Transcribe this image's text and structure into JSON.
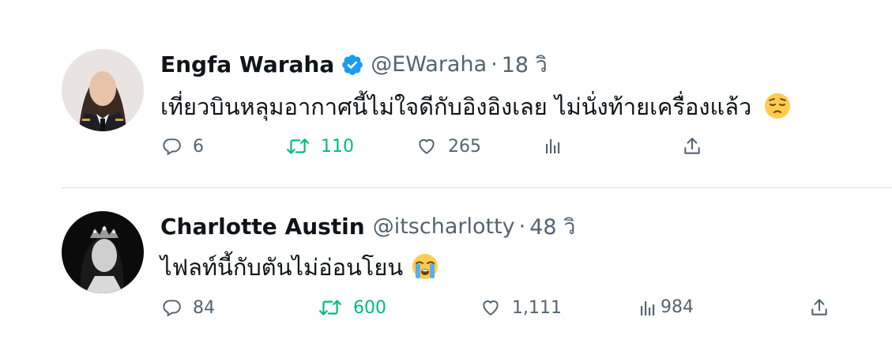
{
  "tweets": [
    {
      "display_name": "Engfa Waraha",
      "verified": true,
      "handle": "@EWaraha",
      "separator": "·",
      "time": "18 วิ",
      "text": "เที่ยวบินหลุมอากาศนี้ไม่ใจดีกับอิงอิงเลย ไม่นั่งท้ายเครื่องแล้ว",
      "emoji": "pensive-face",
      "replies": "6",
      "retweets": "110",
      "likes": "265",
      "views": ""
    },
    {
      "display_name": "Charlotte Austin",
      "verified": false,
      "handle": "@itscharlotty",
      "separator": "·",
      "time": "48 วิ",
      "text": "ไฟลท์นี้กับตันไม่อ่อนโยน",
      "emoji": "loudly-crying-face",
      "replies": "84",
      "retweets": "600",
      "likes": "1,111",
      "views": "984"
    }
  ],
  "colors": {
    "text": "#0f1419",
    "secondary": "#536471",
    "retweet_green": "#00ba7c",
    "verified_blue": "#1d9bf0",
    "divider": "#d8dde1"
  }
}
